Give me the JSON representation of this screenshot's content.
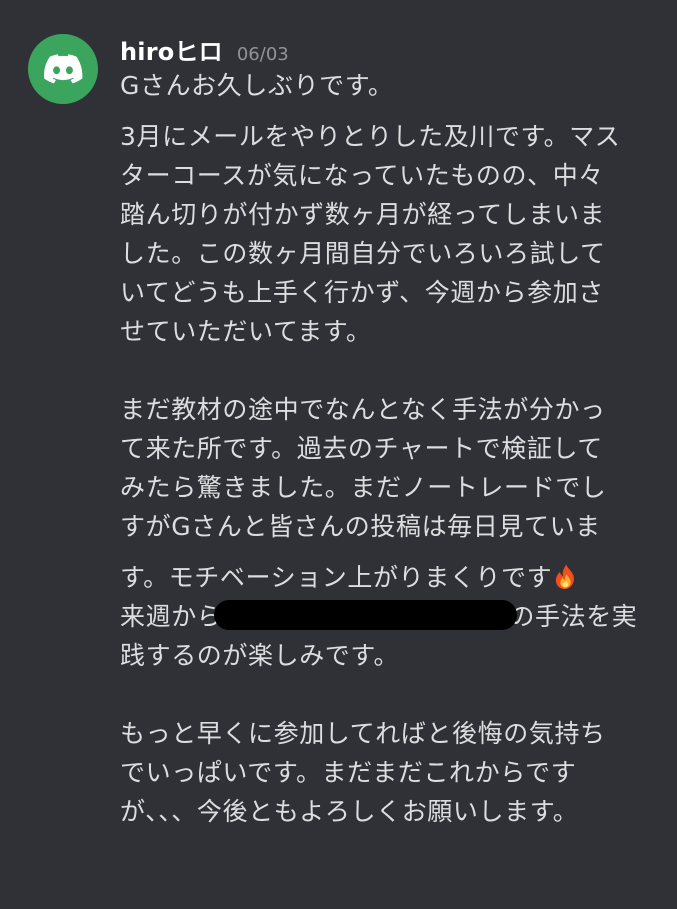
{
  "message": {
    "author": "hiroヒロ",
    "timestamp": "06/03",
    "avatar_icon": "discord-logo-icon",
    "avatar_color": "#3ba55d",
    "lines": [
      "Gさんお久しぶりです。",
      "3月にメールをやりとりした及川です。マス",
      "ターコースが気になっていたものの、中々",
      "踏ん切りが付かず数ヶ月が経ってしまいま",
      "した。この数ヶ月間自分でいろいろ試して",
      "いてどうも上手く行かず、今週から参加さ",
      "せていただいてます。",
      "まだ教材の途中でなんとなく手法が分かっ",
      "て来た所です。過去のチャートで検証して",
      "みたら驚きました。まだノートレードでし",
      "すがGさんと皆さんの投稿は毎日見ていま",
      "す。モチベーション上がりまくりです",
      "来週から",
      "の手法を実",
      "践するのが楽しみです。",
      "もっと早くに参加してればと後悔の気持ち",
      "でいっぱいです。まだまだこれからです",
      "が、、、今後ともよろしくお願いします。"
    ],
    "emoji": "fire-icon"
  }
}
